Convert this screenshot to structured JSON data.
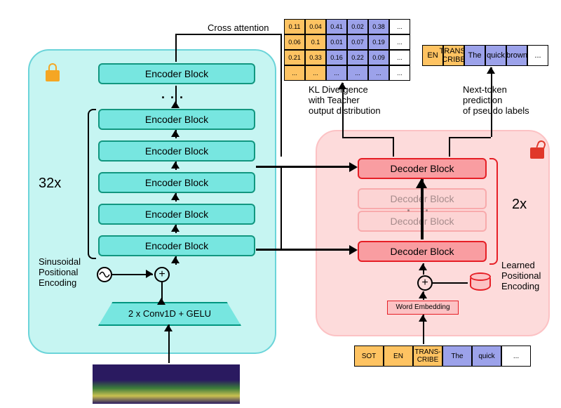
{
  "labels": {
    "cross": "Cross attention",
    "kl": "KL Divergence\nwith Teacher\noutput distribution",
    "next": "Next-token\nprediction\nof pseudo labels",
    "x32": "32x",
    "x2": "2x",
    "sinpe": "Sinusoidal\nPositional\nEncoding",
    "lpe": "Learned\nPositional\nEncoding",
    "enc": "Encoder Block",
    "dec": "Decoder Block",
    "conv": "2 x Conv1D + GELU",
    "emb": "Word Embedding"
  },
  "matrix": [
    [
      "0.11",
      "0.04",
      "0.41",
      "0.02",
      "0.38",
      "..."
    ],
    [
      "0.06",
      "0.1",
      "0.01",
      "0.07",
      "0.19",
      "..."
    ],
    [
      "0.21",
      "0.33",
      "0.16",
      "0.22",
      "0.09",
      "..."
    ],
    [
      "...",
      "...",
      "...",
      "...",
      "...",
      "..."
    ]
  ],
  "out_tokens": [
    "EN",
    "TRANS-\nCRIBE",
    "The",
    "quick",
    "brown",
    "..."
  ],
  "in_tokens": [
    "SOT",
    "EN",
    "TRANS-\nCRIBE",
    "The",
    "quick",
    "..."
  ]
}
